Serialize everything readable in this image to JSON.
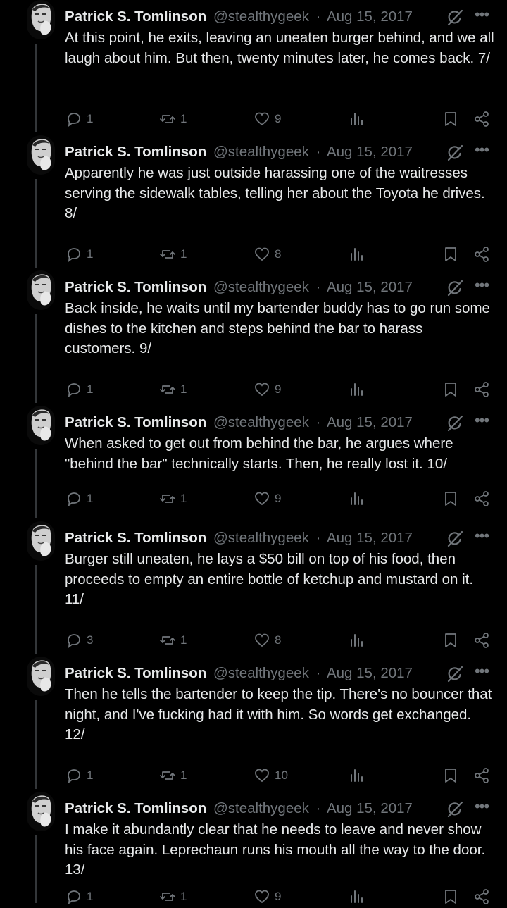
{
  "author": {
    "name": "Patrick S. Tomlinson",
    "handle": "@stealthygeek",
    "separator": "·"
  },
  "icons": {
    "reply": "reply-icon",
    "retweet": "retweet-icon",
    "like": "like-icon",
    "views": "views-icon",
    "bookmark": "bookmark-icon",
    "share": "share-icon",
    "grok": "grok-icon",
    "more": "more-icon"
  },
  "colors": {
    "background": "#000000",
    "text": "#e7e9ea",
    "muted": "#71767b",
    "thread_line": "#333639"
  },
  "tweets": [
    {
      "date": "Aug 15, 2017",
      "text": "At this point, he exits, leaving an uneaten burger behind, and we all laugh about him. But then, twenty minutes later, he comes back. 7/",
      "replies": "1",
      "retweets": "1",
      "likes": "9"
    },
    {
      "date": "Aug 15, 2017",
      "text": "Apparently he was just outside harassing one of the waitresses serving the sidewalk tables, telling her about the Toyota he drives. 8/",
      "replies": "1",
      "retweets": "1",
      "likes": "8"
    },
    {
      "date": "Aug 15, 2017",
      "text": "Back inside, he waits until my bartender buddy has to go run some dishes to the kitchen and steps behind the bar to harass customers. 9/",
      "replies": "1",
      "retweets": "1",
      "likes": "9"
    },
    {
      "date": "Aug 15, 2017",
      "text": "When asked to get out from behind the bar, he argues where \"behind the bar\" technically starts. Then, he really lost it. 10/",
      "replies": "1",
      "retweets": "1",
      "likes": "9"
    },
    {
      "date": "Aug 15, 2017",
      "text": "Burger still uneaten, he lays a $50 bill on top of his food, then proceeds to empty an entire bottle of ketchup and mustard on it. 11/",
      "replies": "3",
      "retweets": "1",
      "likes": "8"
    },
    {
      "date": "Aug 15, 2017",
      "text": "Then he tells the bartender to keep the tip. There's no bouncer that night, and I've fucking had it with him. So words get exchanged. 12/",
      "replies": "1",
      "retweets": "1",
      "likes": "10"
    },
    {
      "date": "Aug 15, 2017",
      "text": "I make it abundantly clear that he needs to leave and never show his face again. Leprechaun runs his mouth all the way to the door. 13/",
      "replies": "1",
      "retweets": "1",
      "likes": "9"
    }
  ]
}
